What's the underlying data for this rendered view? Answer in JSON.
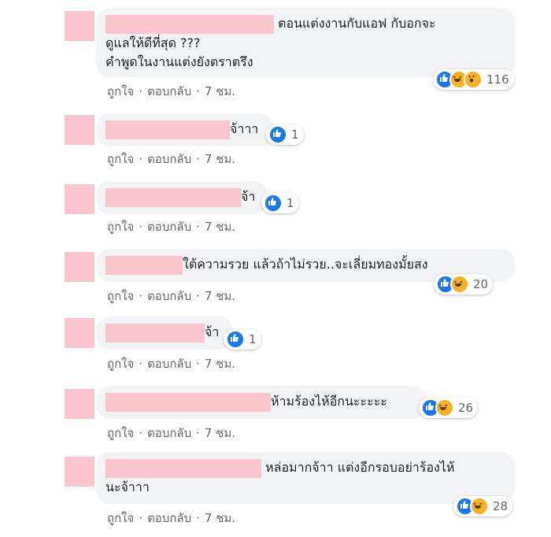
{
  "colors": {
    "redaction": "#fbc5cf",
    "bubble": "#f2f3f5",
    "like": "#1877f2",
    "haha": "#f7b125"
  },
  "actions": {
    "like": "ถูกใจ",
    "sep": "·",
    "reply": "ตอบกลับ",
    "time": "7 ชม."
  },
  "comments": [
    {
      "line1": "ตอนแต่งงานกับแอฟ กับอกจะ",
      "line2": "ดูแลให้ดีที่สุด ???",
      "line3": "คำพูดในงานแต่งยังตราตรึง",
      "reactions": [
        "like-icon",
        "haha-icon",
        "wow-icon"
      ],
      "count": "116"
    },
    {
      "line1": "จ้าาา",
      "reactions": [
        "like-icon"
      ],
      "count": "1"
    },
    {
      "line1": "จ้า",
      "reactions": [
        "like-icon"
      ],
      "count": "1"
    },
    {
      "line1": "ใต้ความรวย แล้วถ้าไม่รวย..จะเลี่ยมทองมั้ยสง",
      "reactions": [
        "like-icon",
        "haha-icon"
      ],
      "count": "20"
    },
    {
      "line1": "จ้า",
      "reactions": [
        "like-icon"
      ],
      "count": "1"
    },
    {
      "line1": "ห้ามร้องไห้อีกนะะะะะ",
      "reactions": [
        "like-icon",
        "haha-icon"
      ],
      "count": "26"
    },
    {
      "line1": "หล่อมากจ้าา แต่งอีกรอบอย่าร้องไห้",
      "line2": "นะจ้าาา",
      "reactions": [
        "like-icon",
        "haha-icon"
      ],
      "count": "28"
    }
  ]
}
